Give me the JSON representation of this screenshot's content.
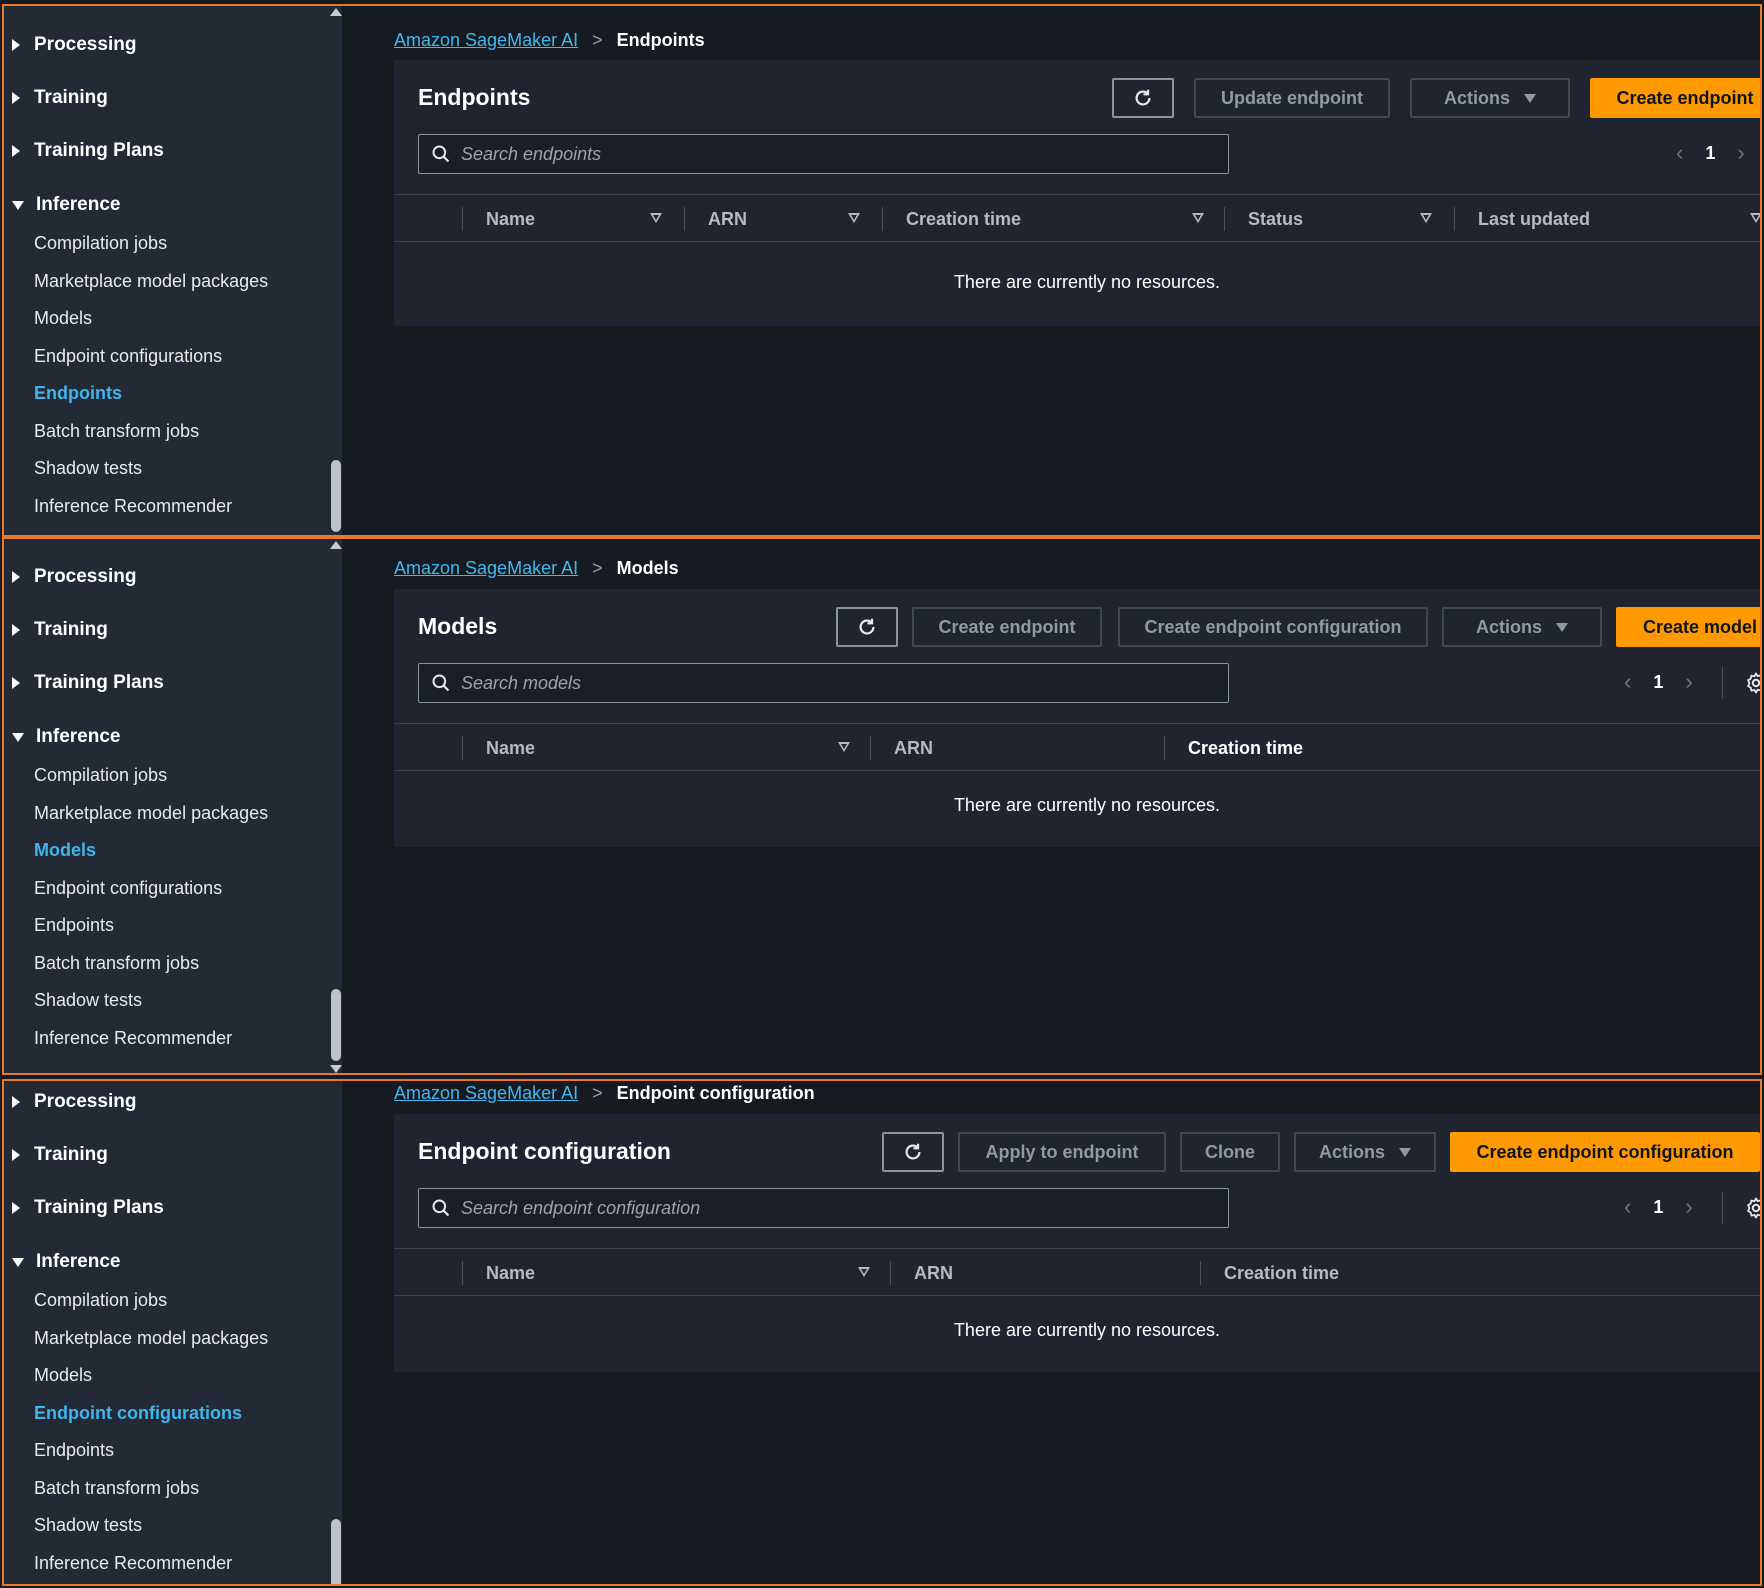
{
  "sidebar": {
    "sections": [
      "Processing",
      "Training",
      "Training Plans",
      "Inference"
    ],
    "items": [
      "Compilation jobs",
      "Marketplace model packages",
      "Models",
      "Endpoint configurations",
      "Endpoints",
      "Batch transform jobs",
      "Shadow tests",
      "Inference Recommender"
    ]
  },
  "colors": {
    "accent": "#ff9900",
    "link": "#45b6ef",
    "active_nav": "#3fb5ec",
    "frame": "#e8782a"
  },
  "panels": [
    {
      "active_nav": "Endpoints",
      "breadcrumb": {
        "root": "Amazon SageMaker AI",
        "current": "Endpoints"
      },
      "title": "Endpoints",
      "buttons": {
        "secondary1": "Update endpoint",
        "actions": "Actions",
        "primary": "Create endpoint"
      },
      "search_placeholder": "Search endpoints",
      "page": "1",
      "columns": [
        "Name",
        "ARN",
        "Creation time",
        "Status",
        "Last updated"
      ],
      "empty_text": "There are currently no resources."
    },
    {
      "active_nav": "Models",
      "breadcrumb": {
        "root": "Amazon SageMaker AI",
        "current": "Models"
      },
      "title": "Models",
      "buttons": {
        "secondary1": "Create endpoint",
        "secondary2": "Create endpoint configuration",
        "actions": "Actions",
        "primary": "Create model"
      },
      "search_placeholder": "Search models",
      "page": "1",
      "columns": [
        "Name",
        "ARN",
        "Creation time"
      ],
      "empty_text": "There are currently no resources."
    },
    {
      "active_nav": "Endpoint configurations",
      "breadcrumb": {
        "root": "Amazon SageMaker AI",
        "current": "Endpoint configuration"
      },
      "title": "Endpoint configuration",
      "buttons": {
        "secondary1": "Apply to endpoint",
        "secondary2": "Clone",
        "actions": "Actions",
        "primary": "Create endpoint configuration"
      },
      "search_placeholder": "Search endpoint configuration",
      "page": "1",
      "columns": [
        "Name",
        "ARN",
        "Creation time"
      ],
      "empty_text": "There are currently no resources."
    }
  ]
}
